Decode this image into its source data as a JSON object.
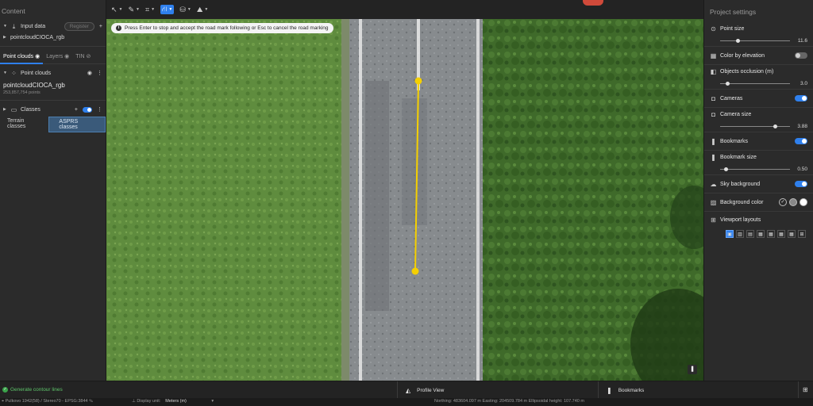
{
  "left_panel": {
    "title": "Content",
    "input_data": {
      "label": "Input data",
      "register": "Register"
    },
    "dataset": "pointcloudCIOCA_rgb",
    "tabs": [
      "Point clouds",
      "Layers",
      "TIN"
    ],
    "point_clouds": {
      "header": "Point clouds",
      "name": "pointcloudCIOCA_rgb",
      "count": "253,857,754 points"
    },
    "classes": {
      "label": "Classes",
      "tabs": [
        "Terrain classes",
        "ASPRS classes"
      ]
    }
  },
  "viewport": {
    "hint": "Press Enter to stop and accept the road mark following or Esc to cancel the road marking",
    "colors": {
      "grass": "#5d8a3c",
      "road": "#8a8a8a",
      "trees": "#3f6a2a",
      "marking": "#f5d000"
    }
  },
  "right_panel": {
    "title": "Project settings",
    "settings": {
      "point_size": {
        "label": "Point size",
        "value": "11.6",
        "fraction": 0.25
      },
      "color_by_elevation": {
        "label": "Color by elevation",
        "on": false
      },
      "objects_occlusion": {
        "label": "Objects occlusion (m)",
        "value": "3.0",
        "fraction": 0.1
      },
      "cameras": {
        "label": "Cameras",
        "on": true
      },
      "camera_size": {
        "label": "Camera size",
        "value": "3.88",
        "fraction": 0.78
      },
      "bookmarks": {
        "label": "Bookmarks",
        "on": true
      },
      "bookmark_size": {
        "label": "Bookmark size",
        "value": "0.50",
        "fraction": 0.08
      },
      "sky_background": {
        "label": "Sky background",
        "on": true
      },
      "background_color": {
        "label": "Background color"
      },
      "viewport_layouts": {
        "label": "Viewport layouts"
      }
    }
  },
  "bottom": {
    "contour": "Generate contour lines",
    "profile_view": "Profile View",
    "bookmarks": "Bookmarks",
    "crs": "Pulkovo 1942(58) / Stereo70 - EPSG:3844",
    "display_unit_label": "Display unit:",
    "display_unit": "Meters (m)",
    "coords": "Northing: 483604.097 m   Easting: 204509.784 m   Ellipsoidal height: 107.740 m"
  }
}
